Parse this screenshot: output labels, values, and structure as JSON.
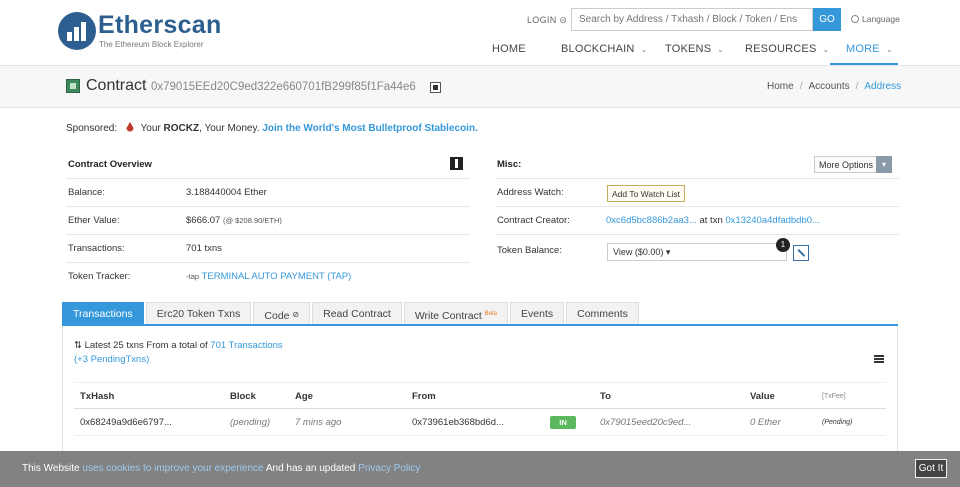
{
  "header": {
    "logo_title": "Etherscan",
    "logo_subtitle": "The Ethereum Block Explorer",
    "login_label": "LOGIN",
    "search_placeholder": "Search by Address / Txhash / Block / Token / Ens",
    "go_label": "GO",
    "language_label": "Language",
    "nav": {
      "home": "HOME",
      "blockchain": "BLOCKCHAIN",
      "tokens": "TOKENS",
      "resources": "RESOURCES",
      "more": "MORE"
    }
  },
  "title_bar": {
    "label": "Contract",
    "address": "0x79015EEd20C9ed322e660701fB299f85f1Fa44e6",
    "breadcrumb": {
      "home": "Home",
      "accounts": "Accounts",
      "current": "Address"
    }
  },
  "sponsor": {
    "prefix": "Sponsored:",
    "brand_pre": "Your",
    "brand": "ROCKZ",
    "brand_post": ", Your Money.",
    "link": "Join the World's Most Bulletproof Stablecoin."
  },
  "overview": {
    "title": "Contract Overview",
    "balance_label": "Balance:",
    "balance_value": "3.188440004 Ether",
    "ether_value_label": "Ether Value:",
    "ether_value": "$666.07",
    "ether_rate": "(@ $208.90/ETH)",
    "transactions_label": "Transactions:",
    "transactions_value": "701 txns",
    "token_tracker_label": "Token Tracker:",
    "token_tracker_value": "TERMINAL AUTO PAYMENT (TAP)"
  },
  "misc": {
    "title": "Misc:",
    "more_options_label": "More Options",
    "address_watch_label": "Address Watch:",
    "watch_button": "Add To Watch List",
    "creator_label": "Contract Creator:",
    "creator_address": "0xc6d5bc886b2aa3...",
    "at_txn": "at txn",
    "creator_txn": "0x13240a4dfadbdb0...",
    "token_balance_label": "Token Balance:",
    "token_balance_value": "View ($0.00) ▾",
    "badge_count": "1"
  },
  "tabs": [
    {
      "label": "Transactions"
    },
    {
      "label": "Erc20 Token Txns"
    },
    {
      "label": "Code"
    },
    {
      "label": "Read Contract"
    },
    {
      "label": "Write Contract",
      "sup": "Beta"
    },
    {
      "label": "Events"
    },
    {
      "label": "Comments"
    }
  ],
  "txn_summary": {
    "prefix": "Latest 25 txns From a total of",
    "link": "701 Transactions",
    "pending": "(+3 PendingTxns)"
  },
  "table": {
    "headers": {
      "txhash": "TxHash",
      "block": "Block",
      "age": "Age",
      "from": "From",
      "to": "To",
      "value": "Value",
      "txfee": "[TxFee]"
    },
    "rows": [
      {
        "txhash": "0x68249a9d6e6797...",
        "block": "(pending)",
        "age": "7 mins ago",
        "from": "0x73961eb368bd6d...",
        "direction": "IN",
        "to": "0x79015eed20c9ed...",
        "value": "0 Ether",
        "txfee": "(Pending)"
      }
    ]
  },
  "cookie_banner": {
    "text_1": "This Website",
    "link_1": "uses cookies to improve your experience",
    "text_2": "And has an updated",
    "link_2": "Privacy Policy",
    "button": "Got It"
  },
  "colors": {
    "accent": "#3498db",
    "brand": "#2c5e8f",
    "in_badge": "#5cb85c"
  }
}
